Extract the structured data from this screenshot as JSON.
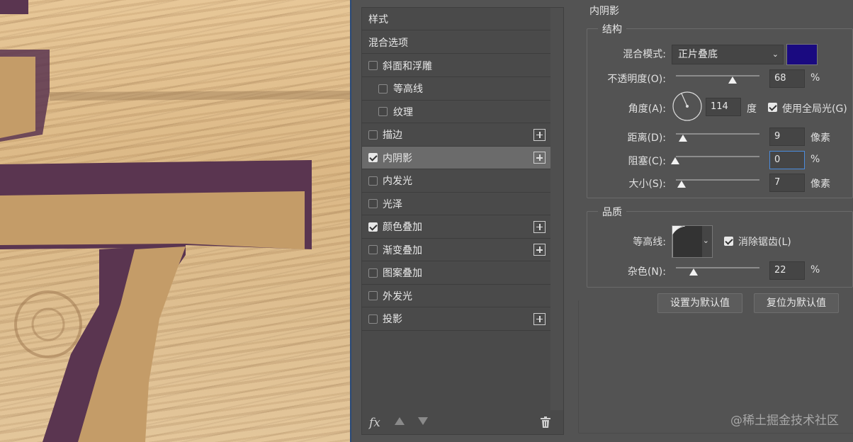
{
  "style_list": {
    "header": "样式",
    "blending_options": "混合选项",
    "items": [
      {
        "label": "斜面和浮雕",
        "checked": false,
        "indent": false,
        "plus": false
      },
      {
        "label": "等高线",
        "checked": false,
        "indent": true,
        "plus": false
      },
      {
        "label": "纹理",
        "checked": false,
        "indent": true,
        "plus": false
      },
      {
        "label": "描边",
        "checked": false,
        "indent": false,
        "plus": true
      },
      {
        "label": "内阴影",
        "checked": true,
        "indent": false,
        "plus": true,
        "selected": true
      },
      {
        "label": "内发光",
        "checked": false,
        "indent": false,
        "plus": false
      },
      {
        "label": "光泽",
        "checked": false,
        "indent": false,
        "plus": false
      },
      {
        "label": "颜色叠加",
        "checked": true,
        "indent": false,
        "plus": true
      },
      {
        "label": "渐变叠加",
        "checked": false,
        "indent": false,
        "plus": true
      },
      {
        "label": "图案叠加",
        "checked": false,
        "indent": false,
        "plus": false
      },
      {
        "label": "外发光",
        "checked": false,
        "indent": false,
        "plus": false
      },
      {
        "label": "投影",
        "checked": false,
        "indent": false,
        "plus": true
      }
    ],
    "fx_label": "fx"
  },
  "inner_shadow": {
    "title": "内阴影",
    "structure": {
      "legend": "结构",
      "blend_mode_label": "混合模式:",
      "blend_mode_value": "正片叠底",
      "shadow_color": "#1a0a80",
      "opacity_label": "不透明度(O):",
      "opacity_value": "68",
      "opacity_unit": "%",
      "angle_label": "角度(A):",
      "angle_value": "114",
      "angle_unit": "度",
      "global_light_label": "使用全局光(G)",
      "global_light_checked": true,
      "distance_label": "距离(D):",
      "distance_value": "9",
      "distance_unit": "像素",
      "choke_label": "阻塞(C):",
      "choke_value": "0",
      "choke_unit": "%",
      "size_label": "大小(S):",
      "size_value": "7",
      "size_unit": "像素"
    },
    "quality": {
      "legend": "品质",
      "contour_label": "等高线:",
      "anti_alias_label": "消除锯齿(L)",
      "anti_alias_checked": true,
      "noise_label": "杂色(N):",
      "noise_value": "22",
      "noise_unit": "%"
    },
    "buttons": {
      "set_default": "设置为默认值",
      "reset_default": "复位为默认值"
    }
  },
  "watermark": "@稀土掘金技术社区",
  "colors": {
    "shadow_brown": "#5a3550",
    "fill_tan": "#c9a06a"
  }
}
